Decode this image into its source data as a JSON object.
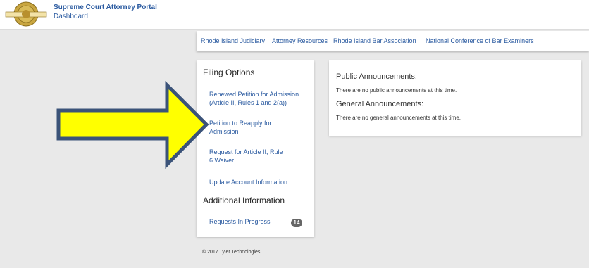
{
  "header": {
    "portal_title": "Supreme Court Attorney Portal",
    "subtitle": "Dashboard",
    "logo": "court-seal"
  },
  "nav": {
    "links": [
      "Rhode Island Judiciary",
      "Attorney Resources",
      "Rhode Island Bar Association",
      "National Conference of Bar Examiners"
    ]
  },
  "filing": {
    "heading": "Filing Options",
    "links": [
      "Renewed Petition for Admission (Article II, Rules 1 and 2(a))",
      "Petition to Reapply for Admission",
      "Request for Article II, Rule 6 Waiver",
      "Update Account Information"
    ],
    "additional_heading": "Additional Information",
    "requests_label": "Requests In Progress",
    "requests_count": "14"
  },
  "announcements": {
    "public_heading": "Public Announcements:",
    "public_text": "There are no public announcements at this time.",
    "general_heading": "General Announcements:",
    "general_text": "There are no general announcements at this time."
  },
  "footer": {
    "text": "© 2017 Tyler Technologies"
  },
  "colors": {
    "link": "#2a5aa0",
    "arrow_fill": "#ffff00",
    "arrow_stroke": "#3b5379"
  }
}
